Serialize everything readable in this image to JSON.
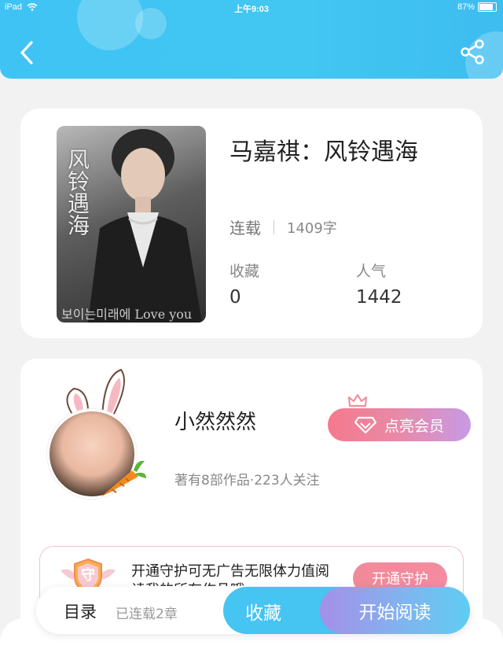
{
  "status_bar": {
    "device": "iPad",
    "time": "上午9:03",
    "battery": "87%"
  },
  "header": {
    "back_icon": "chevron-left-icon",
    "share_icon": "share-icon",
    "accent_color": "#42c6f2"
  },
  "book": {
    "title": "马嘉祺：风铃遇海",
    "cover_title": "风铃遇海",
    "cover_subtitle": "보이는미래에 Love you",
    "status": "连载",
    "word_count": "1409字",
    "favorites_label": "收藏",
    "favorites_value": "0",
    "popularity_label": "人气",
    "popularity_value": "1442"
  },
  "author": {
    "name": "小然然然",
    "info": "著有8部作品·223人关注",
    "vip_button": "点亮会员",
    "guard_text": "开通守护可无广告无限体力值阅读我的所有作品哦",
    "guard_badge": "守",
    "guard_button": "开通守护"
  },
  "bottom_bar": {
    "toc": "目录",
    "chapters": "已连载2章",
    "favorite": "收藏",
    "read": "开始阅读"
  }
}
